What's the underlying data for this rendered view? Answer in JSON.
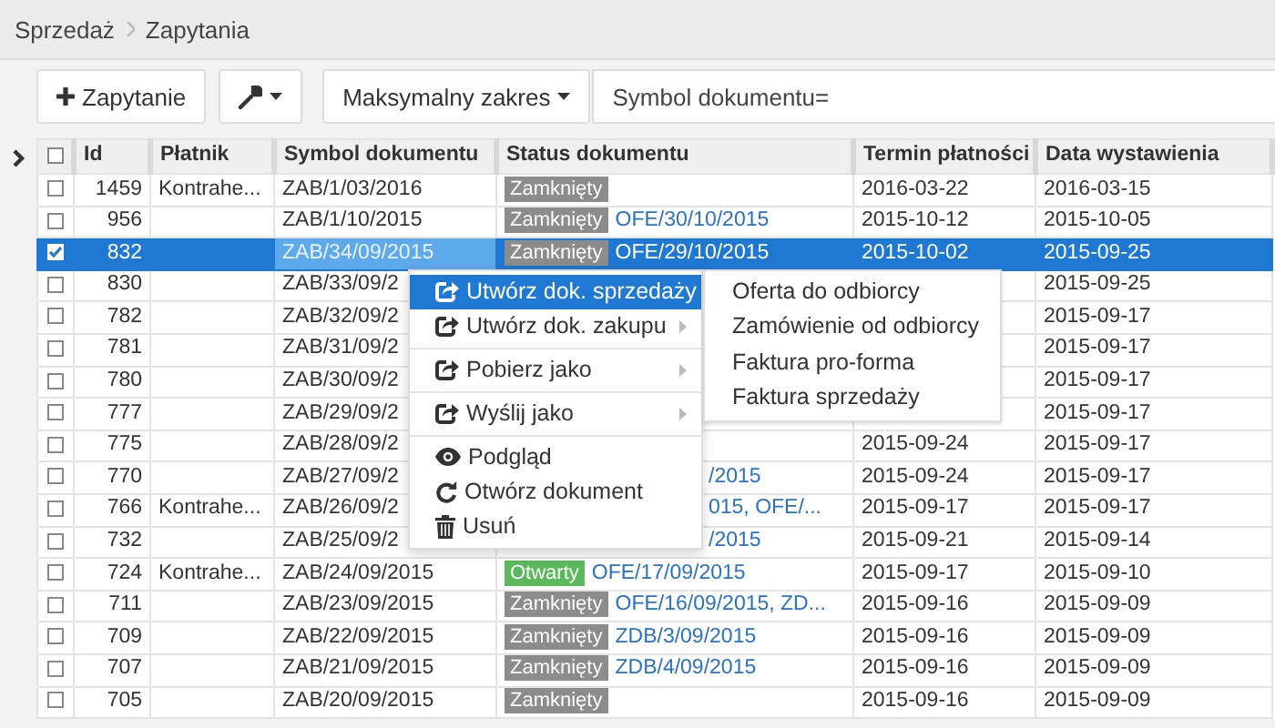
{
  "breadcrumb": [
    {
      "label": "Sprzedaż"
    },
    {
      "label": "Zapytania"
    }
  ],
  "toolbar": {
    "add_button": "Zapytanie",
    "range_dropdown": "Maksymalny zakres",
    "search": {
      "value": "Symbol dokumentu="
    }
  },
  "table": {
    "header_checkbox": {
      "checked": false
    },
    "columns": [
      "Id",
      "Płatnik",
      "Symbol dokumentu",
      "Status dokumentu",
      "Termin płatności",
      "Data wystawienia"
    ],
    "rows": [
      {
        "kind": "full",
        "checked": false,
        "selected": false,
        "id": "1459",
        "payer": "Kontrahe...",
        "symbol": "ZAB/1/03/2016",
        "status": {
          "label": "Zamknięty",
          "color": "#8c8c8c"
        },
        "due": "2016-03-22",
        "issued": "2016-03-15"
      },
      {
        "kind": "full",
        "checked": false,
        "selected": false,
        "id": "956",
        "symbol": "ZAB/1/10/2015",
        "status": {
          "label": "Zamknięty",
          "color": "#8c8c8c"
        },
        "links": "OFE/30/10/2015",
        "due": "2015-10-12",
        "issued": "2015-10-05"
      },
      {
        "kind": "full",
        "checked": true,
        "selected": true,
        "id": "832",
        "symbol": "ZAB/34/09/2015",
        "status": {
          "label": "Zamknięty",
          "color": "#8c8c8c"
        },
        "links": "OFE/29/10/2015",
        "due": "2015-10-02",
        "issued": "2015-09-25"
      },
      {
        "kind": "partial",
        "checked": false,
        "selected": false,
        "id": "830",
        "symbol": "ZAB/33/09/2",
        "issued": "2015-09-25"
      },
      {
        "kind": "partial",
        "checked": false,
        "selected": false,
        "id": "782",
        "symbol": "ZAB/32/09/2",
        "issued": "2015-09-17"
      },
      {
        "kind": "partial",
        "checked": false,
        "selected": false,
        "id": "781",
        "symbol": "ZAB/31/09/2",
        "issued": "2015-09-17"
      },
      {
        "kind": "partial",
        "checked": false,
        "selected": false,
        "id": "780",
        "symbol": "ZAB/30/09/2",
        "issued": "2015-09-17"
      },
      {
        "kind": "partial",
        "checked": false,
        "selected": false,
        "id": "777",
        "symbol": "ZAB/29/09/2",
        "issued": "2015-09-17"
      },
      {
        "kind": "partial",
        "checked": false,
        "selected": false,
        "id": "775",
        "symbol": "ZAB/28/09/2",
        "due": "2015-09-24",
        "issued": "2015-09-17"
      },
      {
        "kind": "partial",
        "checked": false,
        "selected": false,
        "id": "770",
        "symbol": "ZAB/27/09/2",
        "links": "/2015",
        "due": "2015-09-24",
        "issued": "2015-09-17"
      },
      {
        "kind": "partial",
        "checked": false,
        "selected": false,
        "id": "766",
        "payer": "Kontrahe...",
        "symbol": "ZAB/26/09/2",
        "links": "015, OFE/...",
        "due": "2015-09-17",
        "issued": "2015-09-17"
      },
      {
        "kind": "partial",
        "checked": false,
        "selected": false,
        "id": "732",
        "symbol": "ZAB/25/09/2",
        "links": "/2015",
        "due": "2015-09-21",
        "issued": "2015-09-14"
      },
      {
        "kind": "full",
        "checked": false,
        "selected": false,
        "id": "724",
        "payer": "Kontrahe...",
        "symbol": "ZAB/24/09/2015",
        "status": {
          "label": "Otwarty",
          "color": "#5cb85c"
        },
        "links": "OFE/17/09/2015",
        "due": "2015-09-17",
        "issued": "2015-09-10"
      },
      {
        "kind": "full",
        "checked": false,
        "selected": false,
        "id": "711",
        "symbol": "ZAB/23/09/2015",
        "status": {
          "label": "Zamknięty",
          "color": "#8c8c8c"
        },
        "links": "OFE/16/09/2015, ZD...",
        "due": "2015-09-16",
        "issued": "2015-09-09"
      },
      {
        "kind": "full",
        "checked": false,
        "selected": false,
        "id": "709",
        "symbol": "ZAB/22/09/2015",
        "status": {
          "label": "Zamknięty",
          "color": "#8c8c8c"
        },
        "links": "ZDB/3/09/2015",
        "due": "2015-09-16",
        "issued": "2015-09-09"
      },
      {
        "kind": "full",
        "checked": false,
        "selected": false,
        "id": "707",
        "symbol": "ZAB/21/09/2015",
        "status": {
          "label": "Zamknięty",
          "color": "#8c8c8c"
        },
        "links": "ZDB/4/09/2015",
        "due": "2015-09-16",
        "issued": "2015-09-09"
      },
      {
        "kind": "full",
        "checked": false,
        "selected": false,
        "id": "705",
        "symbol": "ZAB/20/09/2015",
        "status": {
          "label": "Zamknięty",
          "color": "#8c8c8c"
        },
        "due": "2015-09-16",
        "issued": "2015-09-09"
      }
    ]
  },
  "context_menu": {
    "items": [
      {
        "kind": "export",
        "label": "Utwórz dok. sprzedaży",
        "submenu": true,
        "selected": true
      },
      {
        "kind": "export",
        "label": "Utwórz dok. zakupu",
        "submenu": true,
        "selected": false
      },
      {
        "kind": "separator"
      },
      {
        "kind": "export",
        "label": "Pobierz jako",
        "submenu": true,
        "selected": false
      },
      {
        "kind": "separator"
      },
      {
        "kind": "export",
        "label": "Wyślij jako",
        "submenu": true,
        "selected": false
      },
      {
        "kind": "separator"
      },
      {
        "kind": "preview",
        "label": "Podgląd",
        "submenu": false,
        "selected": false
      },
      {
        "kind": "reload",
        "label": "Otwórz dokument",
        "submenu": false,
        "selected": false
      },
      {
        "kind": "delete",
        "label": "Usuń",
        "submenu": false,
        "selected": false
      }
    ],
    "submenu": [
      {
        "label": "Oferta do odbiorcy"
      },
      {
        "label": "Zamówienie od odbiorcy"
      },
      {
        "label": "Faktura pro-forma"
      },
      {
        "label": "Faktura sprzedaży"
      }
    ]
  }
}
